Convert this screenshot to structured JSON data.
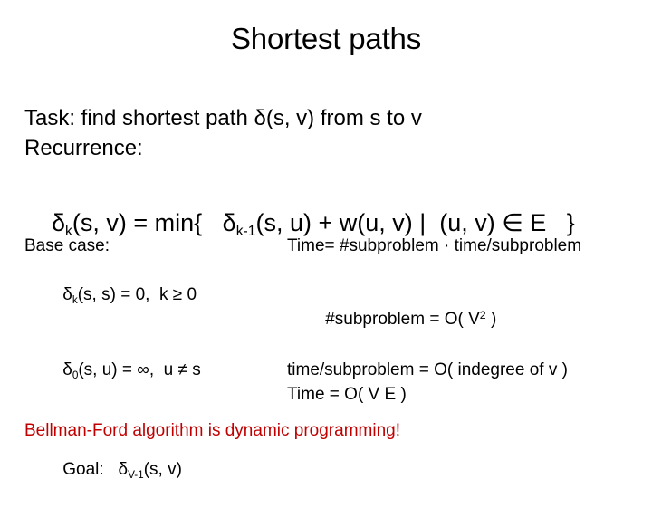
{
  "slide": {
    "title": "Shortest paths",
    "background_color": "#FFFFFF",
    "text_color": "#000000",
    "accent_color": "#C00000"
  },
  "intro": {
    "task_line": "Task: find shortest path δ(s, v) from s to v",
    "recurrence_label": "Recurrence:"
  },
  "recurrence": {
    "delta": "δ",
    "k_sub": "k",
    "lhs_args": "(s, v) = min{   ",
    "delta2": "δ",
    "k_minus_1_sub": "k-1",
    "rhs": "(s, u) + w(u, v) |  (u, v) ∈ E   }"
  },
  "left_column": {
    "base_case_label": "Base case:",
    "base_line_1": {
      "delta": "δ",
      "sub": "k",
      "rest": "(s, s) = 0,  k ≥ 0"
    },
    "base_line_2": {
      "delta": "δ",
      "sub": "0",
      "rest": "(s, u) = ∞,  u ≠ s"
    },
    "goal_label": "Goal:   ",
    "goal_value": {
      "delta": "δ",
      "sub": "V-1",
      "rest": "(s, v)"
    }
  },
  "right_column": {
    "time_formula": "Time= #subproblem · time/subproblem",
    "subproblem_count": {
      "prefix": "#subproblem = O( V",
      "sup": "2",
      "suffix": " )"
    },
    "time_per_subproblem": "time/subproblem = O( indegree of v )",
    "total_time": "Time = O( V E )"
  },
  "conclusion": {
    "text": "Bellman-Ford algorithm is dynamic programming!"
  }
}
